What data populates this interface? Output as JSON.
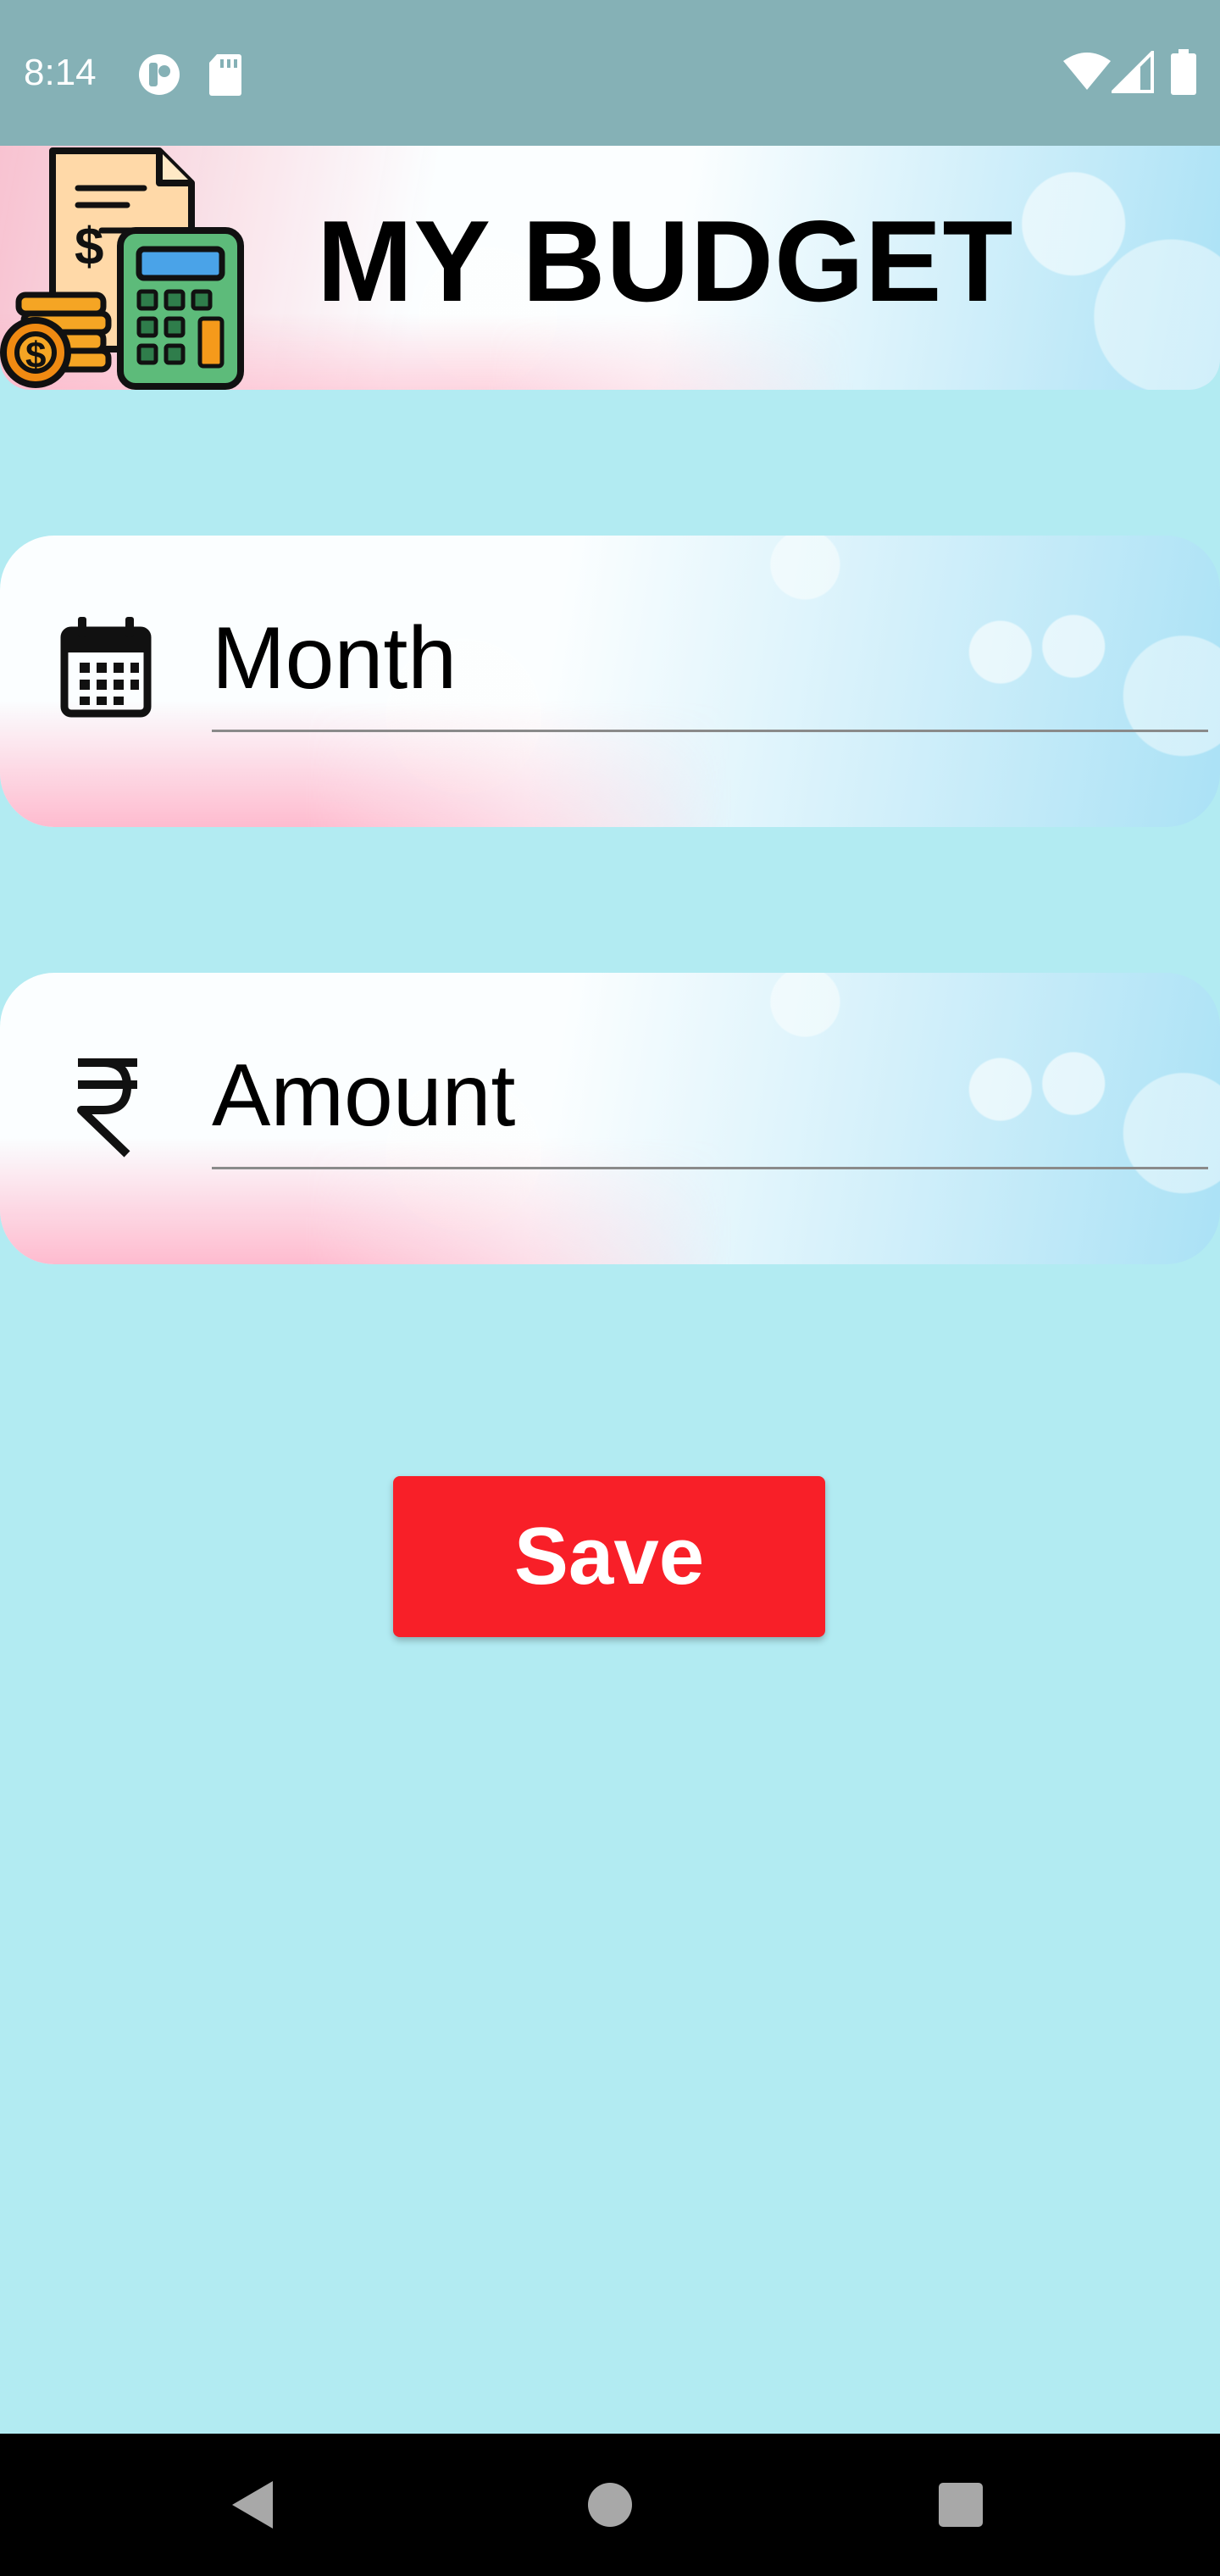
{
  "status_bar": {
    "time": "8:14",
    "icons": [
      "vpn-key-icon",
      "sd-card-icon",
      "wifi-icon",
      "cell-signal-icon",
      "battery-icon"
    ]
  },
  "header": {
    "title": "MY BUDGET",
    "logo_icon": "budget-calculator-logo"
  },
  "form": {
    "month": {
      "icon": "calendar-icon",
      "placeholder": "Month",
      "value": ""
    },
    "amount": {
      "icon": "rupee-icon",
      "placeholder": "Amount",
      "value": ""
    },
    "save_label": "Save"
  },
  "nav_bar": {
    "buttons": [
      "back-icon",
      "home-icon",
      "recents-icon"
    ]
  },
  "colors": {
    "background": "#b2ebf2",
    "status_bar": "#85b1b6",
    "save_button": "#f81f28",
    "nav_bar": "#000000"
  }
}
